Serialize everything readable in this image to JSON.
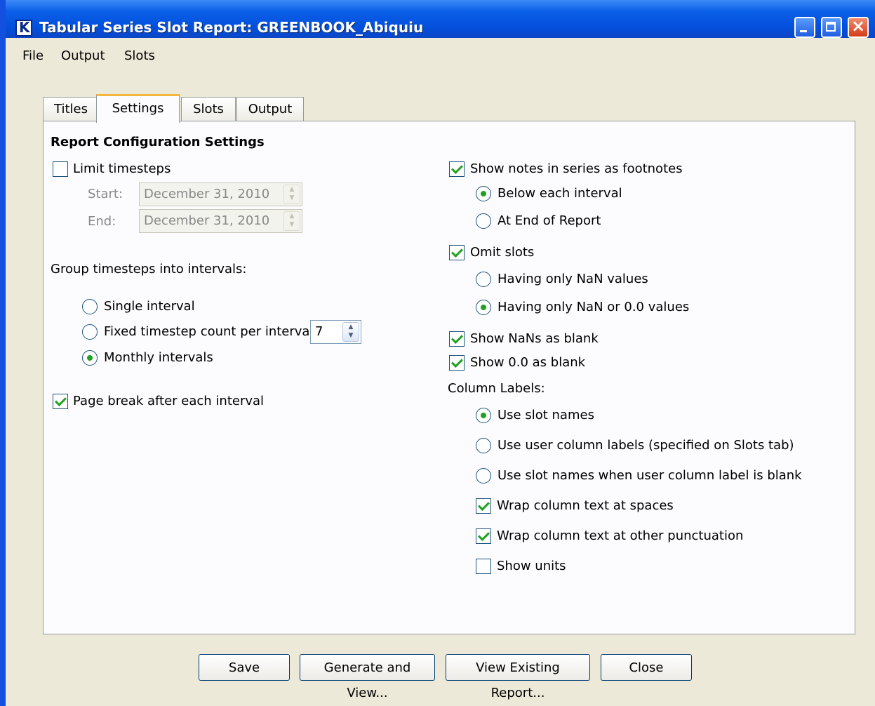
{
  "window": {
    "title": "Tabular Series Slot Report: GREENBOOK_Abiquiu"
  },
  "menu": {
    "file": "File",
    "output": "Output",
    "slots": "Slots"
  },
  "tabs": [
    "Titles",
    "Settings",
    "Slots",
    "Output"
  ],
  "active_tab": "Settings",
  "left": {
    "heading": "Report Configuration Settings",
    "limit_timesteps": {
      "label": "Limit timesteps",
      "checked": false
    },
    "start": {
      "label": "Start:",
      "value": "December 31, 2010"
    },
    "end": {
      "label": "End:",
      "value": "December 31, 2010"
    },
    "group_label": "Group timesteps into intervals:",
    "single_interval": {
      "label": "Single interval",
      "selected": false
    },
    "fixed_count": {
      "label": "Fixed timestep count per interval",
      "selected": false,
      "value": "7"
    },
    "monthly": {
      "label": "Monthly intervals",
      "selected": true
    },
    "page_break": {
      "label": "Page break after each interval",
      "checked": true
    }
  },
  "right": {
    "show_notes": {
      "label": "Show notes in series as footnotes",
      "checked": true
    },
    "below_interval": {
      "label": "Below each interval",
      "selected": true
    },
    "end_of_report": {
      "label": "At End of Report",
      "selected": false
    },
    "omit_slots": {
      "label": "Omit slots",
      "checked": true
    },
    "only_nan": {
      "label": "Having only NaN values",
      "selected": false
    },
    "only_nan_zero": {
      "label": "Having only NaN or 0.0 values",
      "selected": true
    },
    "nans_blank": {
      "label": "Show NaNs as blank",
      "checked": true
    },
    "zero_blank": {
      "label": "Show 0.0 as blank",
      "checked": true
    },
    "column_labels": "Column Labels:",
    "use_slot_names": {
      "label": "Use slot names",
      "selected": true
    },
    "use_user_labels": {
      "label": "Use user column labels (specified on Slots tab)",
      "selected": false
    },
    "use_slot_names_blank": {
      "label": "Use slot names when user column label is blank",
      "selected": false
    },
    "wrap_spaces": {
      "label": "Wrap column text at spaces",
      "checked": true
    },
    "wrap_punct": {
      "label": "Wrap column text at other punctuation",
      "checked": true
    },
    "show_units": {
      "label": "Show units",
      "checked": false
    }
  },
  "buttons": {
    "save": "Save",
    "generate": "Generate and View...",
    "view": "View Existing Report...",
    "close": "Close"
  },
  "colors": {
    "titlebar": "#0a5fe8",
    "window_bg": "#ece9d8",
    "check_green": "#21a121",
    "tab_highlight": "#f5b53e"
  }
}
